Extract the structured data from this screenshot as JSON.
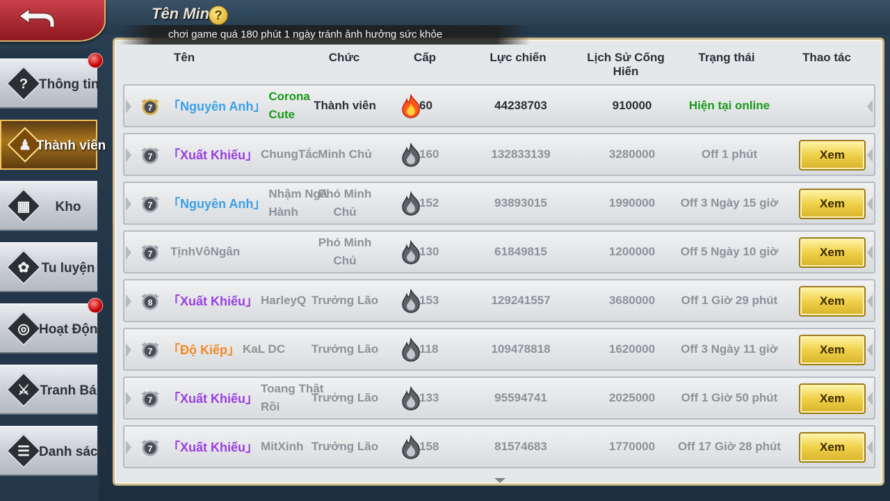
{
  "window": {
    "title": "Tên Minh",
    "help_glyph": "?"
  },
  "sidebar": {
    "items": [
      {
        "label": "Thông tin",
        "icon": "question-icon",
        "glyph": "?",
        "badge": true,
        "active": false
      },
      {
        "label": "Thành viên",
        "icon": "members-icon",
        "glyph": "♟",
        "badge": false,
        "active": true
      },
      {
        "label": "Kho",
        "icon": "warehouse-icon",
        "glyph": "▦",
        "badge": false,
        "active": false
      },
      {
        "label": "Tu luyện",
        "icon": "cultivation-icon",
        "glyph": "✿",
        "badge": false,
        "active": false
      },
      {
        "label": "Hoạt Động",
        "icon": "activity-icon",
        "glyph": "◎",
        "badge": true,
        "active": false
      },
      {
        "label": "Tranh Bá",
        "icon": "sword-icon",
        "glyph": "⚔",
        "badge": false,
        "active": false
      },
      {
        "label": "Danh sách",
        "icon": "list-icon",
        "glyph": "☰",
        "badge": false,
        "active": false
      }
    ]
  },
  "table": {
    "headers": {
      "name": "Tên",
      "role": "Chức",
      "level": "Cấp",
      "power": "Lực chiến",
      "contribution": "Lịch Sử Cống Hiến",
      "status": "Trạng thái",
      "action": "Thao tác"
    },
    "notice": "chơi game quá 180 phút 1 ngày tránh ảnh hưởng sức khỏe",
    "view_label": "Xem",
    "rows": [
      {
        "rank": "7",
        "realm": "「Nguyên Anh」",
        "realm_color": "#3aa0e8",
        "name": "Corona Cute",
        "name_color": "#1a9a1a",
        "role": "Thành viên",
        "level": "60",
        "power": "44238703",
        "contribution": "910000",
        "status": "Hiện tại online",
        "online": true
      },
      {
        "rank": "7",
        "realm": "「Xuất Khiếu」",
        "realm_color": "#9a3ee0",
        "name": "ChungTắc",
        "role": "Minh Chủ",
        "level": "160",
        "power": "132833139",
        "contribution": "3280000",
        "status": "Off 1 phút",
        "online": false
      },
      {
        "rank": "7",
        "realm": "「Nguyên Anh」",
        "realm_color": "#3aa0e8",
        "name": "Nhậm Ngã Hành",
        "role": "Phó Minh Chủ",
        "level": "152",
        "power": "93893015",
        "contribution": "1990000",
        "status": "Off 3 Ngày 15 giờ",
        "online": false
      },
      {
        "rank": "7",
        "realm": "",
        "realm_color": "#9a3ee0",
        "name": "TịnhVôNgân",
        "role": "Phó Minh Chủ",
        "level": "130",
        "power": "61849815",
        "contribution": "1200000",
        "status": "Off 5 Ngày 10 giờ",
        "online": false
      },
      {
        "rank": "8",
        "realm": "「Xuất Khiếu」",
        "realm_color": "#9a3ee0",
        "name": "HarleyQ",
        "role": "Trưởng Lão",
        "level": "153",
        "power": "129241557",
        "contribution": "3680000",
        "status": "Off 1 Giờ 29 phút",
        "online": false
      },
      {
        "rank": "7",
        "realm": "「Độ Kiếp」",
        "realm_color": "#f08a24",
        "name": "KaL DC",
        "role": "Trưởng Lão",
        "level": "118",
        "power": "109478818",
        "contribution": "1620000",
        "status": "Off 3 Ngày 11 giờ",
        "online": false
      },
      {
        "rank": "7",
        "realm": "「Xuất Khiếu」",
        "realm_color": "#9a3ee0",
        "name": "Toang Thật Rồi",
        "role": "Trưởng Lão",
        "level": "133",
        "power": "95594741",
        "contribution": "2025000",
        "status": "Off 1 Giờ 50 phút",
        "online": false
      },
      {
        "rank": "7",
        "realm": "「Xuất Khiếu」",
        "realm_color": "#9a3ee0",
        "name": "MitXinh",
        "role": "Trưởng Lão",
        "level": "158",
        "power": "81574683",
        "contribution": "1770000",
        "status": "Off 17 Giờ 28 phút",
        "online": false
      }
    ]
  }
}
